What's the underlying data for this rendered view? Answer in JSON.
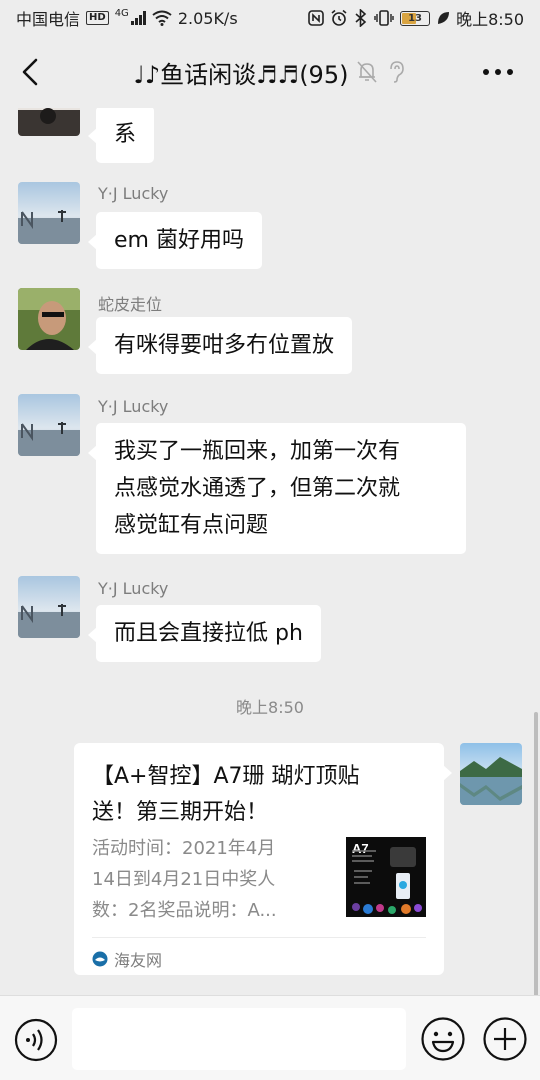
{
  "status_bar": {
    "carrier": "中国电信",
    "hd_badge": "HD",
    "network": "4G",
    "speed": "2.05K/s",
    "battery": "13",
    "time": "晚上8:50"
  },
  "header": {
    "title": "♩♪鱼话闲谈♬♬(95)",
    "icons": [
      "back-icon",
      "mute-bell-icon",
      "earpiece-icon",
      "more-icon"
    ]
  },
  "messages": [
    {
      "sender": "",
      "text": "系",
      "avatar": "partial-avatar"
    },
    {
      "sender": "Y·J Lucky",
      "text": "em 菌好用吗",
      "avatar": "lake-avatar"
    },
    {
      "sender": "蛇皮走位",
      "text": "有咪得要咁多冇位置放",
      "avatar": "man-avatar"
    },
    {
      "sender": "Y·J Lucky",
      "text_lines": [
        "我买了一瓶回来，加第一次有",
        "点感觉水通透了，但第二次就",
        "感觉缸有点问题"
      ],
      "avatar": "lake-avatar"
    },
    {
      "sender": "Y·J Lucky",
      "text": "而且会直接拉低 ph",
      "avatar": "lake-avatar"
    }
  ],
  "time_divider": "晚上8:50",
  "card": {
    "title_lines": [
      "【A+智控】A7珊 瑚灯顶贴",
      "送！第三期开始！"
    ],
    "desc_lines": [
      "活动时间：2021年4月",
      "14日到4月21日中奖人",
      "数：2名奖品说明：A..."
    ],
    "thumb_label": "A7",
    "source": "海友网"
  },
  "input": {
    "placeholder": ""
  },
  "colors": {
    "background": "#ededed",
    "bubble": "#ffffff",
    "meta": "#7d7d7d"
  }
}
